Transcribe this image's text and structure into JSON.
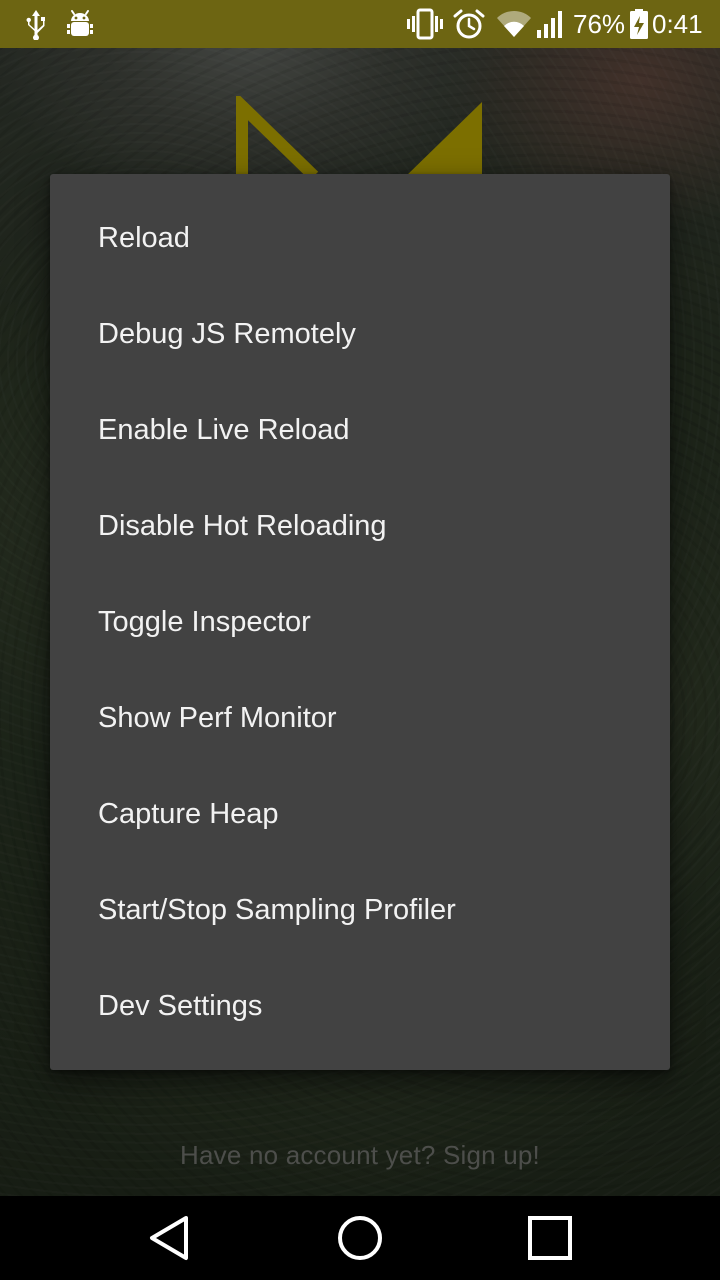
{
  "status_bar": {
    "battery_percent": "76%",
    "time": "0:41",
    "icons": [
      "usb-icon",
      "android-debug-icon",
      "vibrate-icon",
      "alarm-icon",
      "wifi-icon",
      "cell-signal-icon",
      "battery-charging-icon"
    ],
    "background_color": "#6d6512"
  },
  "dev_menu": {
    "items": [
      {
        "label": "Reload"
      },
      {
        "label": "Debug JS Remotely"
      },
      {
        "label": "Enable Live Reload"
      },
      {
        "label": "Disable Hot Reloading"
      },
      {
        "label": "Toggle Inspector"
      },
      {
        "label": "Show Perf Monitor"
      },
      {
        "label": "Capture Heap"
      },
      {
        "label": "Start/Stop Sampling Profiler"
      },
      {
        "label": "Dev Settings"
      }
    ],
    "background_color": "#424242"
  },
  "background_app": {
    "signup_text": "Have no account yet? Sign up!",
    "logo_color": "#c8b400"
  },
  "nav_bar": {
    "buttons": [
      "back-icon",
      "home-icon",
      "recents-icon"
    ]
  }
}
